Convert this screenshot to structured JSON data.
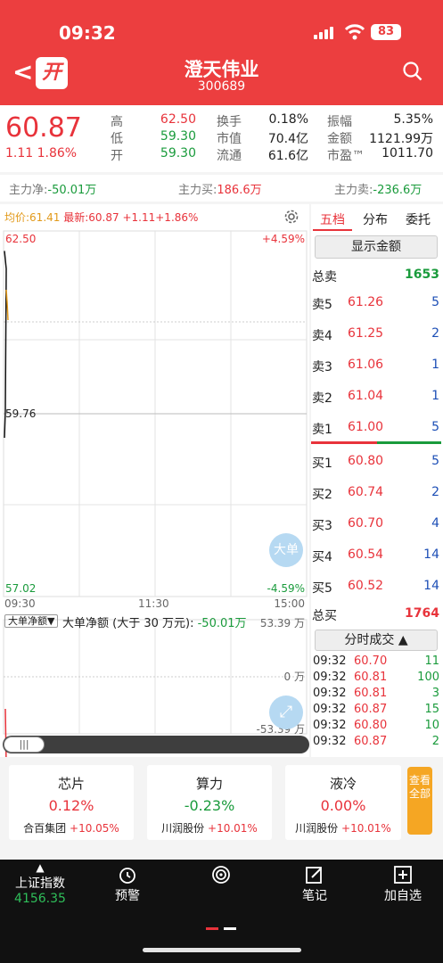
{
  "status_bar": {
    "time": "09:32",
    "battery": "83"
  },
  "header": {
    "back": "<",
    "open_badge": "开",
    "stock_name": "澄天伟业",
    "stock_code": "300689"
  },
  "quote": {
    "price": "60.87",
    "change": "1.11",
    "change_pct": "1.86%",
    "high_label": "高",
    "high": "62.50",
    "low_label": "低",
    "low": "59.30",
    "open_label": "开",
    "open": "59.30",
    "turnover_label": "换手",
    "turnover": "0.18%",
    "mktcap_label": "市值",
    "mktcap": "70.4亿",
    "float_label": "流通",
    "float": "61.6亿",
    "amplitude_label": "振幅",
    "amplitude": "5.35%",
    "amount_label": "金额",
    "amount": "1121.99万",
    "pe_label": "市盈™",
    "pe": "1011.70"
  },
  "flow": {
    "net_label": "主力净:",
    "net": "-50.01万",
    "buy_label": "主力买:",
    "buy": "186.6万",
    "sell_label": "主力卖:",
    "sell": "-236.6万"
  },
  "chart": {
    "avg_label": "均价:",
    "avg": "61.41",
    "last_label": "最新:",
    "last": "60.87",
    "last_chg": "+1.11",
    "last_pct": "+1.86%",
    "top_price": "62.50",
    "top_pct": "+4.59%",
    "mid_price": "59.76",
    "bot_price": "57.02",
    "bot_pct": "-4.59%",
    "time_start": "09:30",
    "time_mid": "11:30",
    "time_end": "15:00",
    "big_order_btn": "大单",
    "sub_dropdown": "大单净额▼",
    "sub_title": "大单净额 (大于 30 万元):",
    "sub_value": "-50.01万",
    "sub_top": "53.39 万",
    "sub_mid": "0 万",
    "sub_bot": "-53.39 万",
    "scroll_knob": "|||"
  },
  "chart_data": {
    "type": "line",
    "title": "",
    "x": [
      "09:30",
      "09:31"
    ],
    "price": [
      62.2,
      59.8
    ],
    "ylim": [
      57.02,
      62.5
    ],
    "sub_ylim": [
      -53.39,
      53.39
    ],
    "sub_values": [
      -30,
      -50.01
    ]
  },
  "orderbook": {
    "tabs": [
      "五档",
      "分布",
      "委托"
    ],
    "show_amount": "显示金额",
    "total_sell_label": "总卖",
    "total_sell": "1653",
    "asks": [
      {
        "label": "卖5",
        "price": "61.26",
        "vol": "5"
      },
      {
        "label": "卖4",
        "price": "61.25",
        "vol": "2"
      },
      {
        "label": "卖3",
        "price": "61.06",
        "vol": "1"
      },
      {
        "label": "卖2",
        "price": "61.04",
        "vol": "1"
      },
      {
        "label": "卖1",
        "price": "61.00",
        "vol": "5"
      }
    ],
    "bids": [
      {
        "label": "买1",
        "price": "60.80",
        "vol": "5"
      },
      {
        "label": "买2",
        "price": "60.74",
        "vol": "2"
      },
      {
        "label": "买3",
        "price": "60.70",
        "vol": "4"
      },
      {
        "label": "买4",
        "price": "60.54",
        "vol": "14"
      },
      {
        "label": "买5",
        "price": "60.52",
        "vol": "14"
      }
    ],
    "total_buy_label": "总买",
    "total_buy": "1764",
    "trades_btn": "分时成交 ▲",
    "trades": [
      {
        "t": "09:32",
        "p": "60.70",
        "v": "11"
      },
      {
        "t": "09:32",
        "p": "60.81",
        "v": "100"
      },
      {
        "t": "09:32",
        "p": "60.81",
        "v": "3"
      },
      {
        "t": "09:32",
        "p": "60.87",
        "v": "15"
      },
      {
        "t": "09:32",
        "p": "60.80",
        "v": "10"
      },
      {
        "t": "09:32",
        "p": "60.87",
        "v": "2"
      }
    ]
  },
  "sectors": [
    {
      "name": "芯片",
      "pct": "0.12%",
      "leader": "合百集团",
      "leader_pct": "+10.05%"
    },
    {
      "name": "算力",
      "pct": "-0.23%",
      "leader": "川润股份",
      "leader_pct": "+10.01%"
    },
    {
      "name": "液冷",
      "pct": "0.00%",
      "leader": "川润股份",
      "leader_pct": "+10.01%"
    }
  ],
  "more_btn": "查看全部",
  "bottom_nav": {
    "index_name": "上证指数",
    "index_value": "4156.35",
    "alert": "预警",
    "notes": "笔记",
    "add": "加自选"
  },
  "colors": {
    "up": "#e8333b",
    "down": "#1a9b3c",
    "header": "#ec3e3f"
  }
}
